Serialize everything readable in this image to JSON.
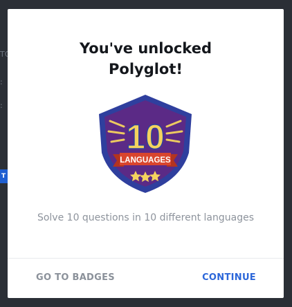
{
  "background": {
    "fragments": [
      "TO",
      ":",
      "T"
    ]
  },
  "modal": {
    "title_line1": "You've unlocked",
    "title_line2": "Polyglot!",
    "badge": {
      "number": "10",
      "ribbon_text": "LANGUAGES",
      "stars": 3,
      "colors": {
        "shield_outer": "#2f3f9e",
        "shield_inner": "#5b2a86",
        "number": "#f4d35e",
        "ribbon": "#d9452e",
        "stars": "#f4d35e"
      }
    },
    "description": "Solve 10 questions in 10 different languages",
    "buttons": {
      "secondary": "GO TO BADGES",
      "primary": "CONTINUE"
    },
    "accent_color": "#2b66d9"
  }
}
